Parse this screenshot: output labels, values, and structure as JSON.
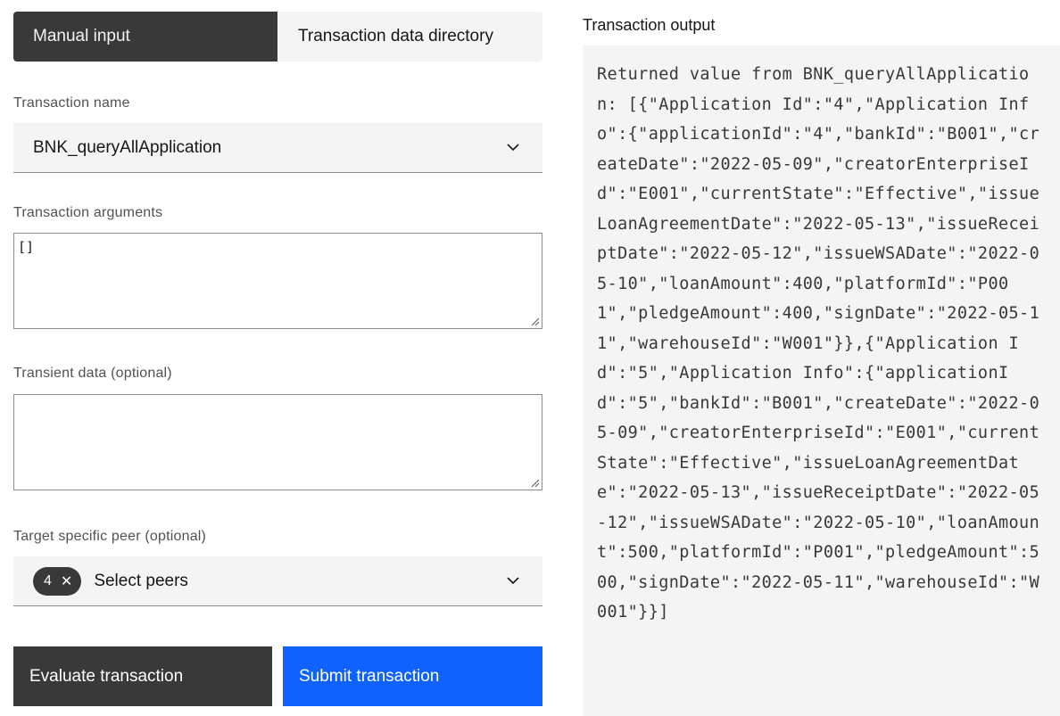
{
  "tabs": [
    {
      "label": "Manual input",
      "active": true
    },
    {
      "label": "Transaction data directory",
      "active": false
    }
  ],
  "form": {
    "transaction_name_label": "Transaction name",
    "transaction_name_value": "BNK_queryAllApplication",
    "transaction_args_label": "Transaction arguments",
    "transaction_args_value": "[]",
    "transient_label": "Transient data (optional)",
    "transient_value": "",
    "peer_label": "Target specific peer (optional)",
    "peer_tag_count": "4",
    "peer_placeholder": "Select peers"
  },
  "buttons": {
    "evaluate": "Evaluate transaction",
    "submit": "Submit transaction"
  },
  "output": {
    "label": "Transaction output",
    "text": "Returned value from BNK_queryAllApplication: [{\"Application Id\":\"4\",\"Application Info\":{\"applicationId\":\"4\",\"bankId\":\"B001\",\"createDate\":\"2022-05-09\",\"creatorEnterpriseId\":\"E001\",\"currentState\":\"Effective\",\"issueLoanAgreementDate\":\"2022-05-13\",\"issueReceiptDate\":\"2022-05-12\",\"issueWSADate\":\"2022-05-10\",\"loanAmount\":400,\"platformId\":\"P001\",\"pledgeAmount\":400,\"signDate\":\"2022-05-11\",\"warehouseId\":\"W001\"}},{\"Application Id\":\"5\",\"Application Info\":{\"applicationId\":\"5\",\"bankId\":\"B001\",\"createDate\":\"2022-05-09\",\"creatorEnterpriseId\":\"E001\",\"currentState\":\"Effective\",\"issueLoanAgreementDate\":\"2022-05-13\",\"issueReceiptDate\":\"2022-05-12\",\"issueWSADate\":\"2022-05-10\",\"loanAmount\":500,\"platformId\":\"P001\",\"pledgeAmount\":500,\"signDate\":\"2022-05-11\",\"warehouseId\":\"W001\"}}]"
  },
  "colors": {
    "primary": "#0f62fe",
    "dark": "#393939",
    "field_bg": "#f4f4f4"
  }
}
